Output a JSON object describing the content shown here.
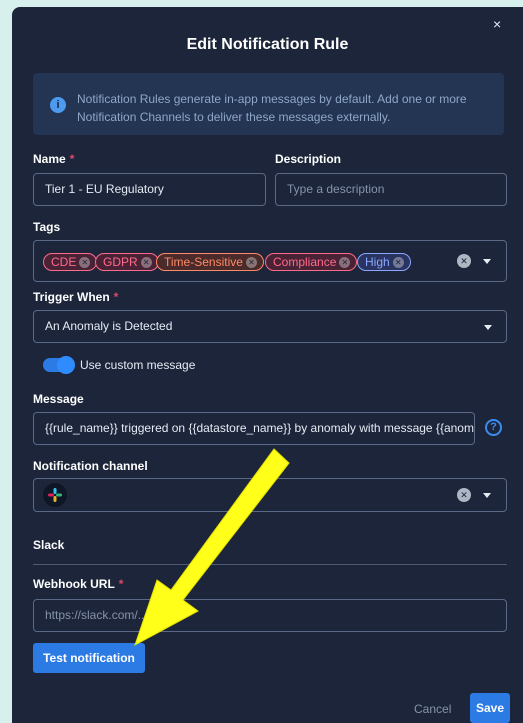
{
  "dialog": {
    "title": "Edit Notification Rule",
    "close_label": "×",
    "info": "Notification Rules generate in-app messages by default. Add one or more Notification Channels to deliver these messages externally."
  },
  "form": {
    "name": {
      "label": "Name",
      "required": "*",
      "value": "Tier 1 - EU Regulatory"
    },
    "description": {
      "label": "Description",
      "placeholder": "Type a description"
    },
    "tags": {
      "label": "Tags",
      "items": [
        {
          "label": "CDE",
          "color": "#ff6b8a"
        },
        {
          "label": "GDPR",
          "color": "#ff6b8a"
        },
        {
          "label": "Time-Sensitive",
          "color": "#ff8a66"
        },
        {
          "label": "Compliance",
          "color": "#ff6b8a"
        },
        {
          "label": "High",
          "color": "#8aa6ff"
        }
      ]
    },
    "trigger": {
      "label": "Trigger When",
      "required": "*",
      "value": "An Anomaly is Detected"
    },
    "custom_message": {
      "label": "Use custom message",
      "enabled": true
    },
    "message": {
      "label": "Message",
      "value": "{{rule_name}} triggered on {{datastore_name}} by anomaly with message {{anomaly_message}}",
      "help_icon": "?"
    },
    "channel": {
      "label": "Notification channel",
      "selected_icon": "slack-icon"
    },
    "slack": {
      "section_title": "Slack",
      "webhook": {
        "label": "Webhook URL",
        "required": "*",
        "placeholder": "https://slack.com/.../hook/"
      }
    }
  },
  "actions": {
    "test": "Test notification",
    "cancel": "Cancel",
    "save": "Save"
  },
  "colors": {
    "background": "#1c2539",
    "accent": "#2c7be5",
    "annotation_arrow": "#ffff19"
  }
}
